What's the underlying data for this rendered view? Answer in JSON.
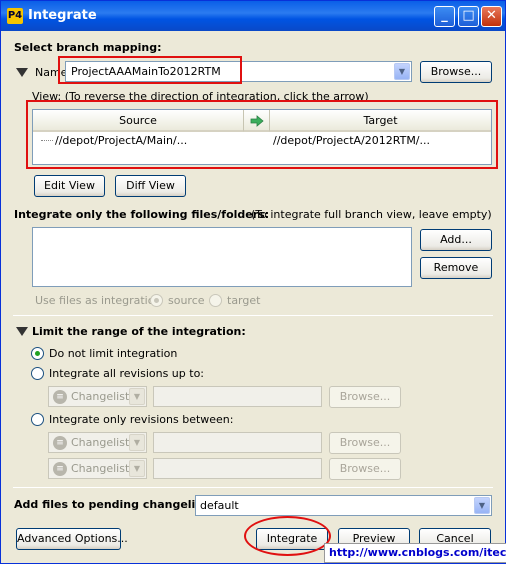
{
  "window": {
    "title": "Integrate",
    "app_icon": "P4",
    "minimize": "_",
    "maximize": "□",
    "close": "✕"
  },
  "branch_mapping": {
    "heading": "Select branch mapping:",
    "name_label": "Name",
    "name_value": "ProjectAAAMainTo2012RTM",
    "browse_label": "Browse...",
    "view_note": "View: (To reverse the direction of integration, click the arrow)",
    "columns": {
      "source": "Source",
      "target": "Target"
    },
    "rows": [
      {
        "source": "//depot/ProjectA/Main/...",
        "target": "//depot/ProjectA/2012RTM/..."
      }
    ],
    "edit_view_label": "Edit View",
    "diff_view_label": "Diff View"
  },
  "files": {
    "heading": "Integrate only the following files/folders:",
    "note": "(To integrate full branch view, leave empty)",
    "add_label": "Add...",
    "remove_label": "Remove",
    "use_files_label": "Use files as integration",
    "option_source": "source",
    "option_target": "target"
  },
  "range": {
    "heading": "Limit the range of the integration:",
    "opt_no_limit": "Do not limit integration",
    "opt_up_to": "Integrate all revisions up to:",
    "opt_between": "Integrate only revisions between:",
    "changelist_label": "Changelist",
    "browse_label": "Browse..."
  },
  "pending": {
    "label": "Add files to pending changelist:",
    "value": "default"
  },
  "footer": {
    "advanced_label": "Advanced Options...",
    "integrate_label": "Integrate",
    "preview_label": "Preview",
    "cancel_label": "Cancel"
  },
  "watermark": "http://www.cnblogs.com/itech"
}
